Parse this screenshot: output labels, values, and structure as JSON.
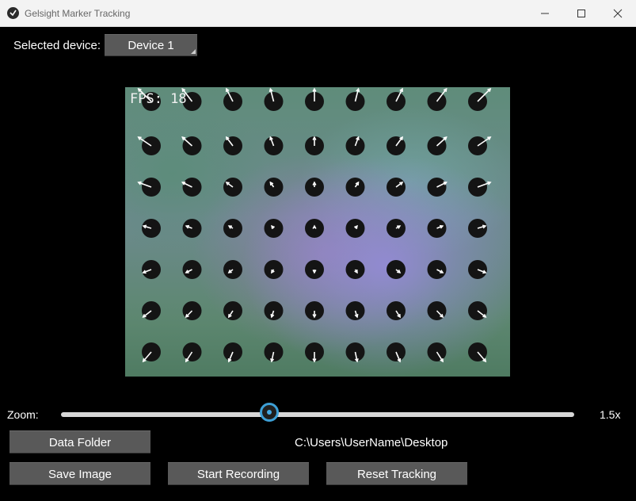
{
  "window": {
    "title": "Gelsight Marker Tracking"
  },
  "device": {
    "label": "Selected device:",
    "selected": "Device 1"
  },
  "video": {
    "fps_text": "FPS: 18",
    "markers": {
      "columns": [
        0,
        1,
        2,
        3,
        4,
        5,
        6,
        7,
        8
      ],
      "rows": [
        0,
        1,
        2,
        3,
        4,
        5,
        6
      ]
    }
  },
  "zoom": {
    "label": "Zoom:",
    "value_text": "1.5x",
    "value_fraction": 0.41
  },
  "buttons": {
    "data_folder": "Data Folder",
    "save_image": "Save Image",
    "start_recording": "Start Recording",
    "reset_tracking": "Reset Tracking"
  },
  "folder_path": "C:\\Users\\UserName\\Desktop",
  "colors": {
    "slider_accent": "#3d9fd6",
    "button_bg": "#595959",
    "background": "#000000"
  }
}
